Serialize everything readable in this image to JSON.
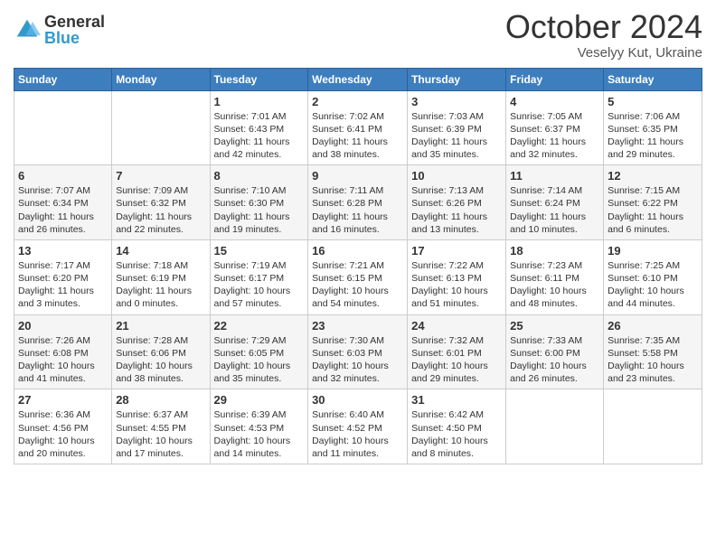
{
  "logo": {
    "general": "General",
    "blue": "Blue"
  },
  "header": {
    "month": "October 2024",
    "location": "Veselyy Kut, Ukraine"
  },
  "days_of_week": [
    "Sunday",
    "Monday",
    "Tuesday",
    "Wednesday",
    "Thursday",
    "Friday",
    "Saturday"
  ],
  "weeks": [
    [
      {
        "day": "",
        "info": ""
      },
      {
        "day": "",
        "info": ""
      },
      {
        "day": "1",
        "info": "Sunrise: 7:01 AM\nSunset: 6:43 PM\nDaylight: 11 hours and 42 minutes."
      },
      {
        "day": "2",
        "info": "Sunrise: 7:02 AM\nSunset: 6:41 PM\nDaylight: 11 hours and 38 minutes."
      },
      {
        "day": "3",
        "info": "Sunrise: 7:03 AM\nSunset: 6:39 PM\nDaylight: 11 hours and 35 minutes."
      },
      {
        "day": "4",
        "info": "Sunrise: 7:05 AM\nSunset: 6:37 PM\nDaylight: 11 hours and 32 minutes."
      },
      {
        "day": "5",
        "info": "Sunrise: 7:06 AM\nSunset: 6:35 PM\nDaylight: 11 hours and 29 minutes."
      }
    ],
    [
      {
        "day": "6",
        "info": "Sunrise: 7:07 AM\nSunset: 6:34 PM\nDaylight: 11 hours and 26 minutes."
      },
      {
        "day": "7",
        "info": "Sunrise: 7:09 AM\nSunset: 6:32 PM\nDaylight: 11 hours and 22 minutes."
      },
      {
        "day": "8",
        "info": "Sunrise: 7:10 AM\nSunset: 6:30 PM\nDaylight: 11 hours and 19 minutes."
      },
      {
        "day": "9",
        "info": "Sunrise: 7:11 AM\nSunset: 6:28 PM\nDaylight: 11 hours and 16 minutes."
      },
      {
        "day": "10",
        "info": "Sunrise: 7:13 AM\nSunset: 6:26 PM\nDaylight: 11 hours and 13 minutes."
      },
      {
        "day": "11",
        "info": "Sunrise: 7:14 AM\nSunset: 6:24 PM\nDaylight: 11 hours and 10 minutes."
      },
      {
        "day": "12",
        "info": "Sunrise: 7:15 AM\nSunset: 6:22 PM\nDaylight: 11 hours and 6 minutes."
      }
    ],
    [
      {
        "day": "13",
        "info": "Sunrise: 7:17 AM\nSunset: 6:20 PM\nDaylight: 11 hours and 3 minutes."
      },
      {
        "day": "14",
        "info": "Sunrise: 7:18 AM\nSunset: 6:19 PM\nDaylight: 11 hours and 0 minutes."
      },
      {
        "day": "15",
        "info": "Sunrise: 7:19 AM\nSunset: 6:17 PM\nDaylight: 10 hours and 57 minutes."
      },
      {
        "day": "16",
        "info": "Sunrise: 7:21 AM\nSunset: 6:15 PM\nDaylight: 10 hours and 54 minutes."
      },
      {
        "day": "17",
        "info": "Sunrise: 7:22 AM\nSunset: 6:13 PM\nDaylight: 10 hours and 51 minutes."
      },
      {
        "day": "18",
        "info": "Sunrise: 7:23 AM\nSunset: 6:11 PM\nDaylight: 10 hours and 48 minutes."
      },
      {
        "day": "19",
        "info": "Sunrise: 7:25 AM\nSunset: 6:10 PM\nDaylight: 10 hours and 44 minutes."
      }
    ],
    [
      {
        "day": "20",
        "info": "Sunrise: 7:26 AM\nSunset: 6:08 PM\nDaylight: 10 hours and 41 minutes."
      },
      {
        "day": "21",
        "info": "Sunrise: 7:28 AM\nSunset: 6:06 PM\nDaylight: 10 hours and 38 minutes."
      },
      {
        "day": "22",
        "info": "Sunrise: 7:29 AM\nSunset: 6:05 PM\nDaylight: 10 hours and 35 minutes."
      },
      {
        "day": "23",
        "info": "Sunrise: 7:30 AM\nSunset: 6:03 PM\nDaylight: 10 hours and 32 minutes."
      },
      {
        "day": "24",
        "info": "Sunrise: 7:32 AM\nSunset: 6:01 PM\nDaylight: 10 hours and 29 minutes."
      },
      {
        "day": "25",
        "info": "Sunrise: 7:33 AM\nSunset: 6:00 PM\nDaylight: 10 hours and 26 minutes."
      },
      {
        "day": "26",
        "info": "Sunrise: 7:35 AM\nSunset: 5:58 PM\nDaylight: 10 hours and 23 minutes."
      }
    ],
    [
      {
        "day": "27",
        "info": "Sunrise: 6:36 AM\nSunset: 4:56 PM\nDaylight: 10 hours and 20 minutes."
      },
      {
        "day": "28",
        "info": "Sunrise: 6:37 AM\nSunset: 4:55 PM\nDaylight: 10 hours and 17 minutes."
      },
      {
        "day": "29",
        "info": "Sunrise: 6:39 AM\nSunset: 4:53 PM\nDaylight: 10 hours and 14 minutes."
      },
      {
        "day": "30",
        "info": "Sunrise: 6:40 AM\nSunset: 4:52 PM\nDaylight: 10 hours and 11 minutes."
      },
      {
        "day": "31",
        "info": "Sunrise: 6:42 AM\nSunset: 4:50 PM\nDaylight: 10 hours and 8 minutes."
      },
      {
        "day": "",
        "info": ""
      },
      {
        "day": "",
        "info": ""
      }
    ]
  ]
}
